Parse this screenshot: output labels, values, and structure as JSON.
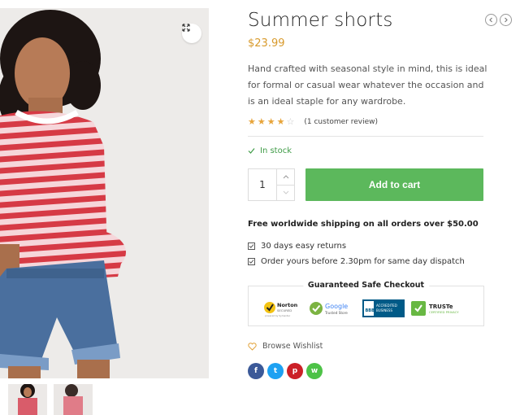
{
  "product": {
    "title": "Summer shorts",
    "price": "$23.99",
    "description": "Hand crafted with seasonal style in mind, this is ideal for formal or casual wear whatever the occasion and is an ideal staple for any wardrobe.",
    "rating": 4,
    "rating_max": 5,
    "review_text": "(1 customer review)",
    "stock_text": "In stock",
    "quantity": "1",
    "add_to_cart_label": "Add to cart"
  },
  "shipping": {
    "headline": "Free worldwide shipping on all orders over $50.00",
    "perks": [
      "30 days easy returns",
      "Order yours before 2.30pm for same day dispatch"
    ]
  },
  "checkout": {
    "title": "Guaranteed Safe Checkout",
    "badges": [
      {
        "name": "Norton",
        "sub": "SECURED",
        "sub2": "powered by Symantec"
      },
      {
        "name": "Google",
        "sub": "Trusted Store"
      },
      {
        "name": "BBB",
        "sub": "ACCREDITED BUSINESS"
      },
      {
        "name": "TRUSTe",
        "sub": "CERTIFIED PRIVACY"
      }
    ]
  },
  "wishlist": {
    "label": "Browse Wishlist"
  },
  "social": [
    {
      "icon": "facebook-icon",
      "glyph": "f",
      "color": "#3b5998"
    },
    {
      "icon": "twitter-icon",
      "glyph": "t",
      "color": "#1da1f2"
    },
    {
      "icon": "pinterest-icon",
      "glyph": "p",
      "color": "#cb2027"
    },
    {
      "icon": "whatsapp-icon",
      "glyph": "w",
      "color": "#4dc247"
    }
  ],
  "colors": {
    "price": "#d89a2c",
    "stars": "#e7a43a",
    "in_stock": "#3e9b46",
    "add_to_cart": "#5cb85c",
    "shirt_red": "#d63a45",
    "shirt_pink": "#f4c2c8",
    "denim": "#4a6f9e"
  },
  "icons": {
    "zoom": "expand-icon",
    "prev": "chevron-left-icon",
    "next": "chevron-right-icon",
    "stock": "checkmark-icon",
    "perk": "checkbox-icon",
    "wishlist": "heart-icon"
  }
}
